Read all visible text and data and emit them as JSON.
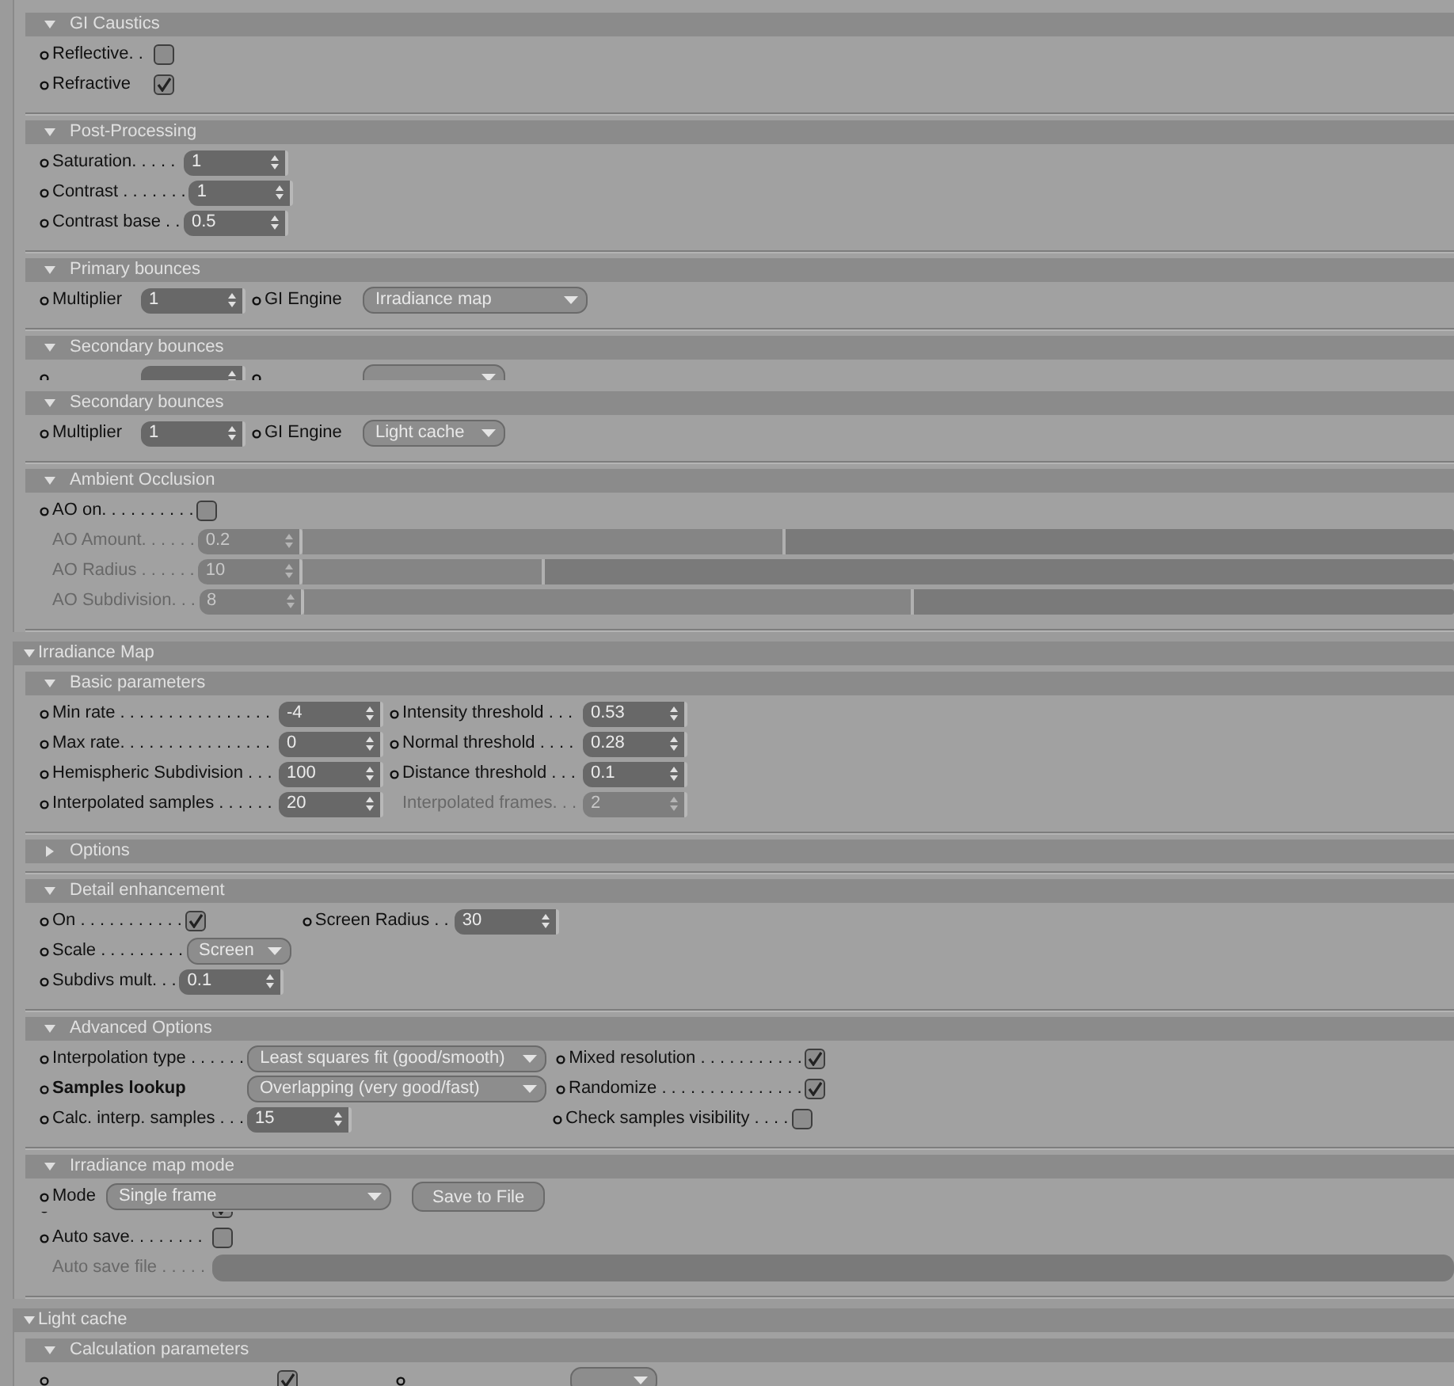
{
  "panels": [
    {
      "sections": [
        {
          "title": "GI Caustics",
          "expanded": true,
          "rows": [
            {
              "items": [
                {
                  "kind": "checkbox",
                  "label": "Reflective. .",
                  "checked": false
                }
              ]
            },
            {
              "items": [
                {
                  "kind": "checkbox",
                  "label": "Refractive",
                  "checked": true
                }
              ]
            }
          ]
        },
        {
          "title": "Post-Processing",
          "expanded": true,
          "rows": [
            {
              "items": [
                {
                  "kind": "spinner",
                  "label": "Saturation. . . . .",
                  "value": "1"
                }
              ]
            },
            {
              "items": [
                {
                  "kind": "spinner",
                  "label": "Contrast . . . . . . .",
                  "value": "1"
                }
              ]
            },
            {
              "items": [
                {
                  "kind": "spinner",
                  "label": "Contrast base . .",
                  "value": "0.5"
                }
              ]
            }
          ]
        },
        {
          "title": "Primary bounces",
          "expanded": true,
          "rows": [
            {
              "items": [
                {
                  "kind": "spinner",
                  "label": "Multiplier",
                  "value": "1"
                },
                {
                  "kind": "dropdown",
                  "label": "GI Engine",
                  "value": "Irradiance map"
                }
              ]
            }
          ]
        },
        {
          "title": "Secondary bounces",
          "expanded": true,
          "rows": [
            {
              "covered_below": true,
              "items": [
                {
                  "kind": "spinner"
                },
                {
                  "kind": "dropdown"
                }
              ]
            }
          ]
        },
        {
          "title": "Secondary bounces",
          "expanded": true,
          "rows": [
            {
              "items": [
                {
                  "kind": "spinner",
                  "label": "Multiplier",
                  "value": "1"
                },
                {
                  "kind": "dropdown",
                  "label": "GI Engine",
                  "value": "Light cache"
                }
              ]
            }
          ]
        },
        {
          "title": "Ambient Occlusion",
          "expanded": true,
          "rows": [
            {
              "items": [
                {
                  "kind": "checkbox",
                  "label": "AO on. . . . . . . . . .",
                  "checked": false
                }
              ]
            },
            {
              "items": [
                {
                  "kind": "slider",
                  "label": "AO Amount. . . . . .",
                  "value": "0.2",
                  "level": 0.42,
                  "disabled": true
                }
              ]
            },
            {
              "items": [
                {
                  "kind": "slider",
                  "label": "AO Radius . . . . . .",
                  "value": "10",
                  "level": 0.21,
                  "disabled": true
                }
              ]
            },
            {
              "items": [
                {
                  "kind": "slider",
                  "label": "AO Subdivision. . .",
                  "value": "8",
                  "level": 0.53,
                  "disabled": true
                }
              ]
            }
          ]
        }
      ]
    },
    {
      "title": "Irradiance Map",
      "expanded": true,
      "sections": [
        {
          "title": "Basic parameters",
          "expanded": true,
          "rows": [
            {
              "items": [
                {
                  "kind": "spinner",
                  "label": "Min rate . . . . . . . . . . . . . . . .",
                  "value": "-4"
                },
                {
                  "kind": "spinner",
                  "label": "Intensity threshold . . .",
                  "value": "0.53"
                }
              ]
            },
            {
              "items": [
                {
                  "kind": "spinner",
                  "label": "Max rate. . . . . . . . . . . . . . . .",
                  "value": "0"
                },
                {
                  "kind": "spinner",
                  "label": "Normal threshold . . . .",
                  "value": "0.28"
                }
              ]
            },
            {
              "items": [
                {
                  "kind": "spinner",
                  "label": "Hemispheric Subdivision . . .",
                  "value": "100"
                },
                {
                  "kind": "spinner",
                  "label": "Distance threshold . . .",
                  "value": "0.1"
                }
              ]
            },
            {
              "items": [
                {
                  "kind": "spinner",
                  "label": "Interpolated samples . . . . . .",
                  "value": "20"
                },
                {
                  "kind": "spinner",
                  "label": "Interpolated frames. . .",
                  "value": "2",
                  "disabled": true
                }
              ]
            }
          ]
        },
        {
          "title": "Options",
          "expanded": false
        },
        {
          "title": "Detail enhancement",
          "expanded": true,
          "rows": [
            {
              "items": [
                {
                  "kind": "checkbox",
                  "label": "On . . . . . . . . . . .",
                  "checked": true
                },
                {
                  "kind": "spinner",
                  "label": "Screen Radius . .",
                  "value": "30"
                }
              ]
            },
            {
              "items": [
                {
                  "kind": "dropdown",
                  "label": "Scale . . . . . . . . .",
                  "value": "Screen"
                }
              ]
            },
            {
              "items": [
                {
                  "kind": "spinner",
                  "label": "Subdivs mult. . .",
                  "value": "0.1"
                }
              ]
            }
          ]
        },
        {
          "title": "Advanced Options",
          "expanded": true,
          "rows": [
            {
              "items": [
                {
                  "kind": "dropdown",
                  "label": "Interpolation type . . . . . .",
                  "value": "Least squares fit (good/smooth)"
                },
                {
                  "kind": "checkbox",
                  "label": "Mixed resolution . . . . . . . . . . .",
                  "checked": true
                }
              ]
            },
            {
              "items": [
                {
                  "kind": "dropdown",
                  "label": "Samples lookup",
                  "bold": true,
                  "value": "Overlapping (very good/fast)"
                },
                {
                  "kind": "checkbox",
                  "label": "Randomize . . . . . . . . . . . . . . .",
                  "checked": true
                }
              ]
            },
            {
              "items": [
                {
                  "kind": "spinner",
                  "label": "Calc. interp. samples . . .",
                  "value": "15"
                },
                {
                  "kind": "checkbox",
                  "label": "Check samples visibility . . . .",
                  "checked": false
                }
              ]
            }
          ]
        },
        {
          "title": "Irradiance map mode",
          "expanded": true,
          "rows": [
            {
              "items": [
                {
                  "kind": "dropdown",
                  "label": "Mode",
                  "value": "Single frame"
                },
                {
                  "kind": "button",
                  "label": "Save to File"
                }
              ]
            },
            {
              "covered_above": true,
              "items": [
                {
                  "kind": "checkbox",
                  "checked": true
                }
              ]
            },
            {
              "items": [
                {
                  "kind": "checkbox",
                  "label": "Auto save. . . . . . . .",
                  "checked": false
                }
              ]
            },
            {
              "items": [
                {
                  "kind": "textfield",
                  "label": "Auto save file . . . . .",
                  "disabled": true
                }
              ]
            }
          ]
        }
      ]
    },
    {
      "title": "Light cache",
      "expanded": true,
      "sections": [
        {
          "title": "Calculation parameters",
          "expanded": true,
          "rows": [
            {
              "items": [
                {
                  "kind": "checkbox",
                  "checked": true
                },
                {
                  "kind": "dropdown"
                }
              ]
            }
          ]
        }
      ]
    }
  ]
}
